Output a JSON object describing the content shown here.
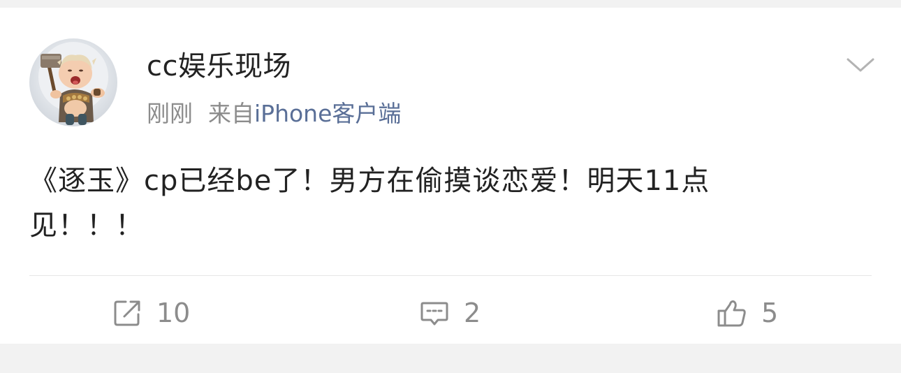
{
  "post": {
    "username": "cc娱乐现场",
    "time": "刚刚",
    "source_prefix": "来自",
    "source_name": "iPhone客户端",
    "text_line1": "《逐玉》cp已经be了！男方在偷摸谈恋爱！明天11点",
    "text_line2": "见！！！",
    "avatar_icon": "avatar-baby-viking-icon",
    "more_icon": "chevron-down-icon"
  },
  "actions": {
    "repost_count": "10",
    "comment_count": "2",
    "like_count": "5",
    "repost_icon": "repost-icon",
    "comment_icon": "comment-icon",
    "like_icon": "thumbs-up-icon"
  },
  "colors": {
    "background": "#f2f2f2",
    "card": "#ffffff",
    "username": "#222222",
    "meta": "#8c8c8c",
    "source_link": "#5a6f97",
    "icon_stroke": "#8c8c8c"
  }
}
